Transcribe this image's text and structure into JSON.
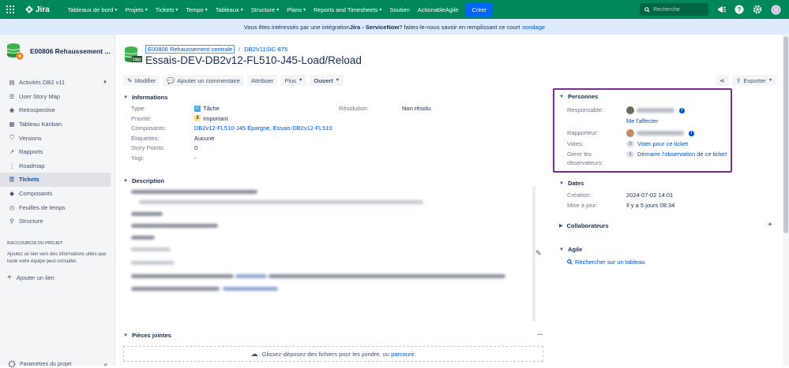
{
  "topnav": {
    "logo": "Jira",
    "menu": [
      {
        "label": "Tableaux de bord",
        "caret": true
      },
      {
        "label": "Projets",
        "caret": true
      },
      {
        "label": "Tickets",
        "caret": true
      },
      {
        "label": "Tempo",
        "caret": true
      },
      {
        "label": "Tableaux",
        "caret": true
      },
      {
        "label": "Structure",
        "caret": true
      },
      {
        "label": "Plans",
        "caret": true
      },
      {
        "label": "Reports and Timesheets",
        "caret": true
      },
      {
        "label": "Soutien",
        "caret": false
      },
      {
        "label": "ActionableAgile",
        "caret": false
      }
    ],
    "create_label": "Créer",
    "search_placeholder": "Recherche",
    "brand_color": "#00875a"
  },
  "banner": {
    "prefix": "Vous êtes intéressés par une intégration ",
    "bold": "Jira - ServiceNow",
    "suffix": " ? faites-le-nous savoir en remplissant ce court",
    "link": "sondage"
  },
  "sidebar": {
    "project_name": "E00806 Rehaussement ...",
    "items": [
      {
        "label": "Activités DB2 v11",
        "icon": "activity-icon",
        "chevron": true
      },
      {
        "label": "User Story Map",
        "icon": "story-map-icon"
      },
      {
        "label": "Retrospective",
        "icon": "retrospective-icon"
      },
      {
        "label": "Tableau Kanban",
        "icon": "kanban-icon"
      },
      {
        "label": "Versions",
        "icon": "versions-icon"
      },
      {
        "label": "Rapports",
        "icon": "reports-icon"
      },
      {
        "label": "Roadmap",
        "icon": "roadmap-icon"
      },
      {
        "label": "Tickets",
        "icon": "tickets-icon",
        "active": true
      },
      {
        "label": "Composants",
        "icon": "components-icon"
      },
      {
        "label": "Feuilles de temps",
        "icon": "timesheets-icon"
      },
      {
        "label": "Structure",
        "icon": "structure-icon"
      }
    ],
    "shortcuts_heading": "RACCOURCIS DU PROJET",
    "shortcuts_text": "Ajoutez un lien vers des informations utiles que toute votre équipe peut consulter.",
    "add_link": "Ajouter un lien",
    "footer": "Paramètres du projet"
  },
  "issue": {
    "breadcrumb_project": "E00806 Rehaussement centrale",
    "breadcrumb_key": "DB2V11SIC-875",
    "title": "Essais-DEV-DB2v12-FL510-J45-Load/Reload",
    "toolbar": {
      "edit": "Modifier",
      "comment": "Ajouter un commentaire",
      "assign": "Attribuer",
      "more": "Plus",
      "status": "Ouvert",
      "export": "Exporter"
    }
  },
  "informations": {
    "heading": "Informations",
    "fields": [
      {
        "label": "Type:",
        "value": "Tâche"
      },
      {
        "label": "Priorité:",
        "value": "Important",
        "badge": "3"
      },
      {
        "label": "Composants:",
        "value": "DB2v12-FL510-J45 Épargne, Essais-DB2v12-FL510"
      },
      {
        "label": "Étiquettes:",
        "value": "Aucune"
      },
      {
        "label": "Story Points:",
        "value": "0"
      },
      {
        "label": "Yogi:",
        "value": "-"
      }
    ],
    "resolution_label": "Résolution:",
    "resolution_value": "Non résolu"
  },
  "description": {
    "heading": "Description"
  },
  "attachments": {
    "heading": "Pièces jointes",
    "drop_text": "Glissez-déposez des fichiers pour les joindre, ou",
    "drop_link": "parcourir."
  },
  "personnes": {
    "heading": "Personnes",
    "assignee_label": "Responsable:",
    "assign_me": "Me l'affecter",
    "reporter_label": "Rapporteur:",
    "votes_label": "Votes:",
    "votes_count": "0",
    "votes_link": "Voter pour ce ticket",
    "watchers_label_1": "Gérer les",
    "watchers_label_2": "observateurs:",
    "watchers_count": "1",
    "watchers_link": "Démarre l'observation de ce ticket",
    "highlight_color": "#7b2c8f"
  },
  "dates": {
    "heading": "Dates",
    "created_label": "Création:",
    "created_value": "2024-07-02 14:01",
    "updated_label": "Mise à jour:",
    "updated_value": "Il y a 5 jours 08:34"
  },
  "collaborateurs": {
    "heading": "Collaborateurs"
  },
  "agile": {
    "heading": "Agile",
    "link": "Rechercher sur un tableau"
  }
}
